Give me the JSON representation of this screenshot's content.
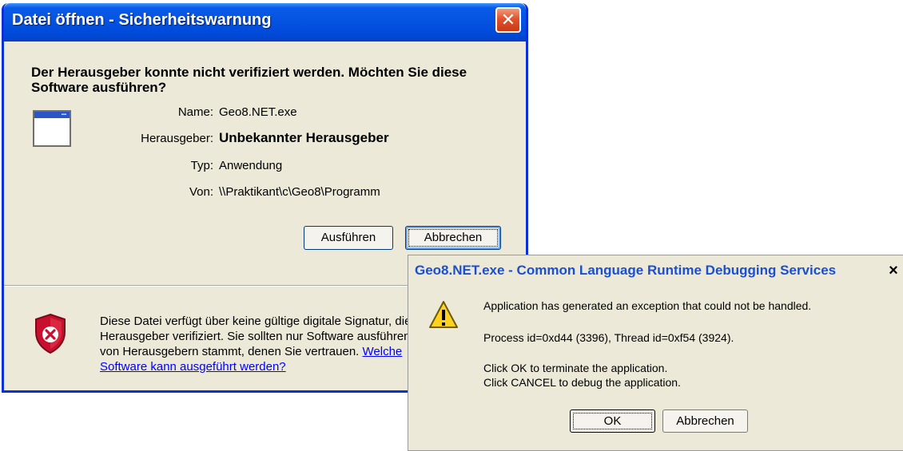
{
  "security_dialog": {
    "title": "Datei öffnen - Sicherheitswarnung",
    "question": "Der Herausgeber konnte nicht verifiziert werden. Möchten Sie diese Software ausführen?",
    "fields": [
      {
        "label": "Name:",
        "value": "Geo8.NET.exe"
      },
      {
        "label": "Herausgeber:",
        "value": "Unbekannter Herausgeber"
      },
      {
        "label": "Typ:",
        "value": "Anwendung"
      },
      {
        "label": "Von:",
        "value": "\\\\Praktikant\\c\\Geo8\\Programm"
      }
    ],
    "run_button": "Ausführen",
    "cancel_button": "Abbrechen",
    "warning_text": "Diese Datei verfügt über keine gültige digitale Signatur, die den Herausgeber verifiziert. Sie sollten nur Software ausführen, die von Herausgebern stammt, denen Sie vertrauen.",
    "warning_link": "Welche Software kann ausgeführt werden?"
  },
  "clr_dialog": {
    "title": "Geo8.NET.exe - Common Language Runtime Debugging Services",
    "close_label": "×",
    "line1": "Application has generated an exception that could not be handled.",
    "line2": "Process id=0xd44 (3396), Thread id=0xf54 (3924).",
    "line3": "Click OK to terminate the application.",
    "line4": "Click CANCEL to debug the application.",
    "ok_button": "OK",
    "cancel_button": "Abbrechen"
  }
}
